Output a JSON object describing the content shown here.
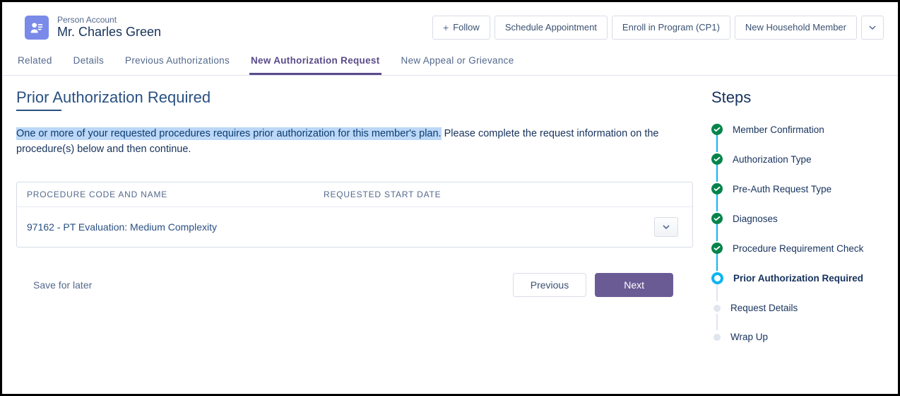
{
  "header": {
    "type_label": "Person Account",
    "account_name": "Mr. Charles Green",
    "follow_label": "Follow",
    "actions": [
      "Schedule Appointment",
      "Enroll in Program (CP1)",
      "New Household Member"
    ]
  },
  "tabs": [
    {
      "label": "Related",
      "active": false
    },
    {
      "label": "Details",
      "active": false
    },
    {
      "label": "Previous Authorizations",
      "active": false
    },
    {
      "label": "New Authorization Request",
      "active": true
    },
    {
      "label": "New Appeal or Grievance",
      "active": false
    }
  ],
  "main": {
    "title": "Prior Authorization Required",
    "highlight_text": "One or more of your requested procedures requires prior authorization for this member's plan.",
    "rest_text": " Please complete the request information on the procedure(s) below and then continue.",
    "table": {
      "col_code": "PROCEDURE CODE AND NAME",
      "col_date": "REQUESTED START DATE",
      "rows": [
        {
          "code": "97162 - PT Evaluation: Medium Complexity",
          "date": ""
        }
      ]
    },
    "save_label": "Save for later",
    "prev_label": "Previous",
    "next_label": "Next"
  },
  "steps_title": "Steps",
  "steps": [
    {
      "label": "Member Confirmation",
      "state": "done"
    },
    {
      "label": "Authorization Type",
      "state": "done"
    },
    {
      "label": "Pre-Auth Request Type",
      "state": "done"
    },
    {
      "label": "Diagnoses",
      "state": "done"
    },
    {
      "label": "Procedure Requirement Check",
      "state": "done"
    },
    {
      "label": "Prior Authorization Required",
      "state": "current"
    },
    {
      "label": "Request Details",
      "state": "future"
    },
    {
      "label": "Wrap Up",
      "state": "future"
    }
  ]
}
